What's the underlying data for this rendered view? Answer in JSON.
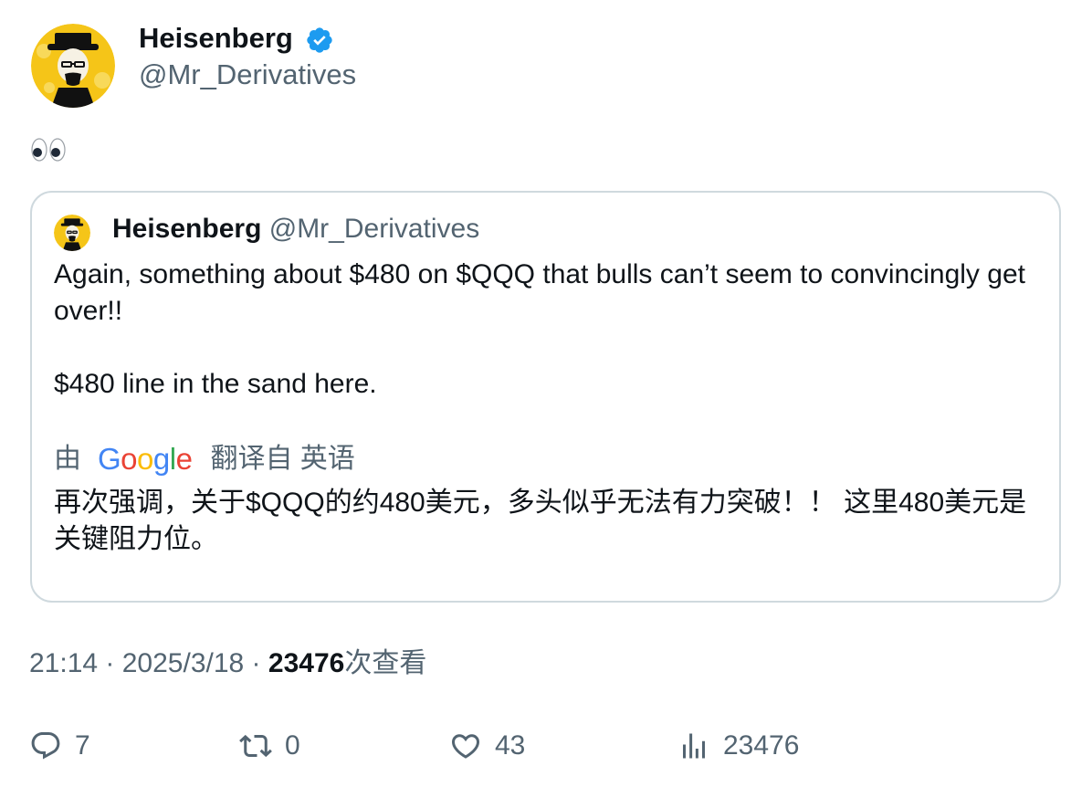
{
  "author": {
    "name": "Heisenberg",
    "handle": "@Mr_Derivatives",
    "verified": true
  },
  "tweet": {
    "text": "👀"
  },
  "quoted": {
    "name": "Heisenberg",
    "handle": "@Mr_Derivatives",
    "paragraph1": "Again, something about $480 on $QQQ that bulls can’t seem to convincingly get over!!",
    "paragraph2": "$480 line in the sand here.",
    "translation": {
      "prefix": "由",
      "provider": "Google",
      "suffix": "翻译自 英语",
      "text": "再次强调，关于$QQQ的约480美元，多头似乎无法有力突破！！ 这里480美元是关键阻力位。"
    }
  },
  "meta": {
    "time": "21:14",
    "date": "2025/3/18",
    "views": "23476",
    "views_suffix": "次查看",
    "separator": " · "
  },
  "actions": {
    "replies": "7",
    "retweets": "0",
    "likes": "43",
    "views": "23476"
  },
  "colors": {
    "text": "#0f1419",
    "secondary": "#536471",
    "verified": "#1d9bf0",
    "border": "#cfd9de",
    "avatar_bg": "#f5c518"
  }
}
